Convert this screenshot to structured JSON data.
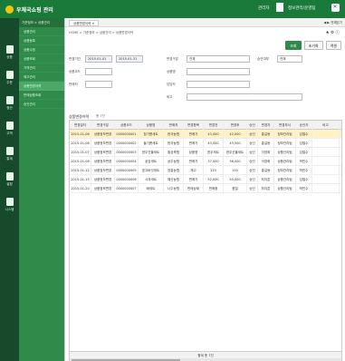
{
  "header": {
    "brand": "우체국쇼핑 관리",
    "user": "관리자",
    "org": "정보관리/운영팀"
  },
  "rail": [
    {
      "label": "상품"
    },
    {
      "label": "주문"
    },
    {
      "label": "정산"
    },
    {
      "label": "고객"
    },
    {
      "label": "통계"
    },
    {
      "label": "설정"
    },
    {
      "label": "시스템"
    }
  ],
  "menu": {
    "head": "기준정보 > 상품관리",
    "items": [
      "상품관리",
      "상품등록",
      "상품수정",
      "상품조회",
      "가격관리",
      "재고관리",
      "상품변경이력",
      "판매상품조회",
      "승인관리"
    ],
    "active_index": 6
  },
  "main": {
    "tab_label": "상품변경이력 ✕",
    "tab_controls": "◀ ▶ 전체닫기",
    "breadcrumb": "HOME > 기준정보 > 상품관리 > 상품변경이력",
    "page_icons": "★ ⚙ ⓘ",
    "buttons": {
      "search": "조회",
      "reset": "초기화",
      "excel": "엑셀"
    }
  },
  "search": {
    "period_label": "변경기간",
    "date_from": "2015-01-01",
    "date_to": "2015-01-31",
    "division_label": "변경구분",
    "division_value": "전체",
    "approval_label": "승인여부",
    "approval_value": "전체",
    "product_code_label": "상품코드",
    "product_name_label": "상품명",
    "seller_label": "판매처",
    "manager_label": "담당자",
    "note_label": "비고"
  },
  "grid": {
    "title": "상품변경이력",
    "count": "총 7건",
    "columns": [
      "변경일자",
      "변경구분",
      "상품코드",
      "상품명",
      "판매처",
      "변경항목",
      "변경전",
      "변경후",
      "승인",
      "변경자",
      "변경부서",
      "승인자",
      "비고"
    ],
    "rows": [
      [
        "2015-01-06",
        "상품정보변경",
        "0000000001",
        "참기름세트",
        "한국농협",
        "판매가",
        "43,000",
        "42,000",
        "승인",
        "홍길동",
        "정보관리팀",
        "김철수",
        ""
      ],
      [
        "2015-01-06",
        "상품정보변경",
        "0000000002",
        "들기름세트",
        "한국농협",
        "판매가",
        "43,000",
        "43,500",
        "승인",
        "홍길동",
        "정보관리팀",
        "김철수",
        ""
      ],
      [
        "2015-01-07",
        "상품정보변경",
        "0000000003",
        "한우선물세트",
        "횡성축협",
        "상품명",
        "한우세트",
        "한우선물세트",
        "승인",
        "이영희",
        "상품관리팀",
        "김철수",
        ""
      ],
      [
        "2015-01-08",
        "상품정보변경",
        "0000000004",
        "곶감세트",
        "상주농협",
        "판매가",
        "37,000",
        "36,000",
        "승인",
        "이영희",
        "상품관리팀",
        "박민수",
        ""
      ],
      [
        "2015-01-12",
        "상품정보변경",
        "0000000005",
        "표고버섯세트",
        "장흥농협",
        "재고",
        "120",
        "150",
        "승인",
        "홍길동",
        "정보관리팀",
        "박민수",
        ""
      ],
      [
        "2015-01-15",
        "상품정보변경",
        "0000000006",
        "사과세트",
        "예산농협",
        "판매가",
        "52,000",
        "50,000",
        "승인",
        "최지훈",
        "상품관리팀",
        "김철수",
        ""
      ],
      [
        "2015-01-20",
        "상품정보변경",
        "0000000007",
        "배세트",
        "나주농협",
        "판매상태",
        "판매중",
        "품절",
        "승인",
        "최지훈",
        "상품관리팀",
        "박민수",
        ""
      ]
    ],
    "highlight_row": 0,
    "footer": "합계  총 7건"
  }
}
